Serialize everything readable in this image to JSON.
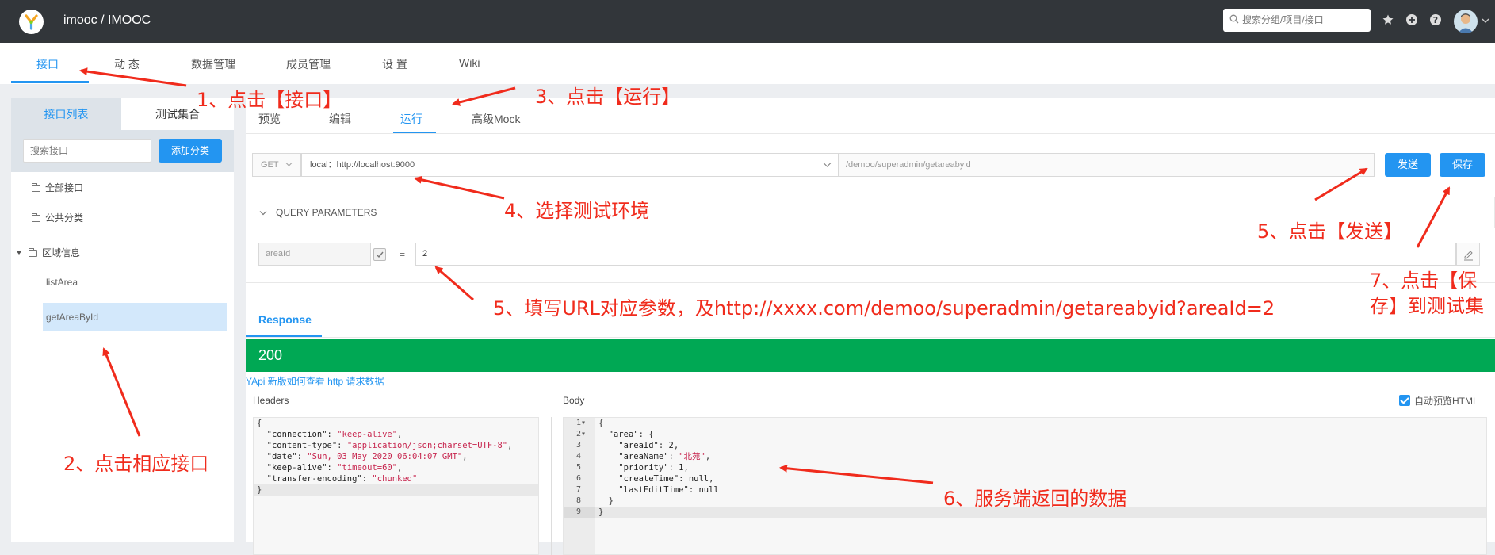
{
  "header": {
    "brand": "imooc / IMOOC",
    "search_placeholder": "搜索分组/项目/接口",
    "icons": [
      "star-icon",
      "plus-circle-icon",
      "question-icon",
      "avatar"
    ]
  },
  "topnav": {
    "tabs": [
      "接口",
      "动 态",
      "数据管理",
      "成员管理",
      "设 置",
      "Wiki"
    ],
    "active": "接口"
  },
  "sidebar": {
    "tabs": [
      "接口列表",
      "测试集合"
    ],
    "search_placeholder": "搜索接口",
    "add_category": "添加分类",
    "tree": {
      "all": "全部接口",
      "public": "公共分类",
      "region": "区域信息",
      "items": [
        "listArea",
        "getAreaById"
      ]
    }
  },
  "panel": {
    "tabs": [
      "预览",
      "编辑",
      "运行",
      "高级Mock"
    ],
    "active_tab": "运行"
  },
  "request": {
    "method": "GET",
    "env": "local：http://localhost:9000",
    "path": "/demoo/superadmin/getareabyid",
    "send": "发送",
    "save": "保存"
  },
  "query": {
    "title": "QUERY PARAMETERS",
    "param_name": "areaId",
    "eq": "=",
    "param_value": "2"
  },
  "response": {
    "tab": "Response",
    "status": "200",
    "help_link": "YApi 新版如何查看 http 请求数据",
    "headers_label": "Headers",
    "body_label": "Body",
    "preview_html": "自动预览HTML"
  },
  "annotations": {
    "a1": "1、点击【接口】",
    "a2": "2、点击相应接口",
    "a3": "3、点击【运行】",
    "a4": "4、选择测试环境",
    "a5_send": "5、点击【发送】",
    "a5_param": "5、填写URL对应参数，及http://xxxx.com/demoo/superadmin/getareabyid?areaId=2",
    "a6": "6、服务端返回的数据",
    "a7_line1": "7、点击【保",
    "a7_line2": "存】到测试集"
  },
  "colors": {
    "header_bg": "#32363a",
    "accent": "#2395f1",
    "success": "#00a854",
    "annotation": "#f02b1c"
  }
}
